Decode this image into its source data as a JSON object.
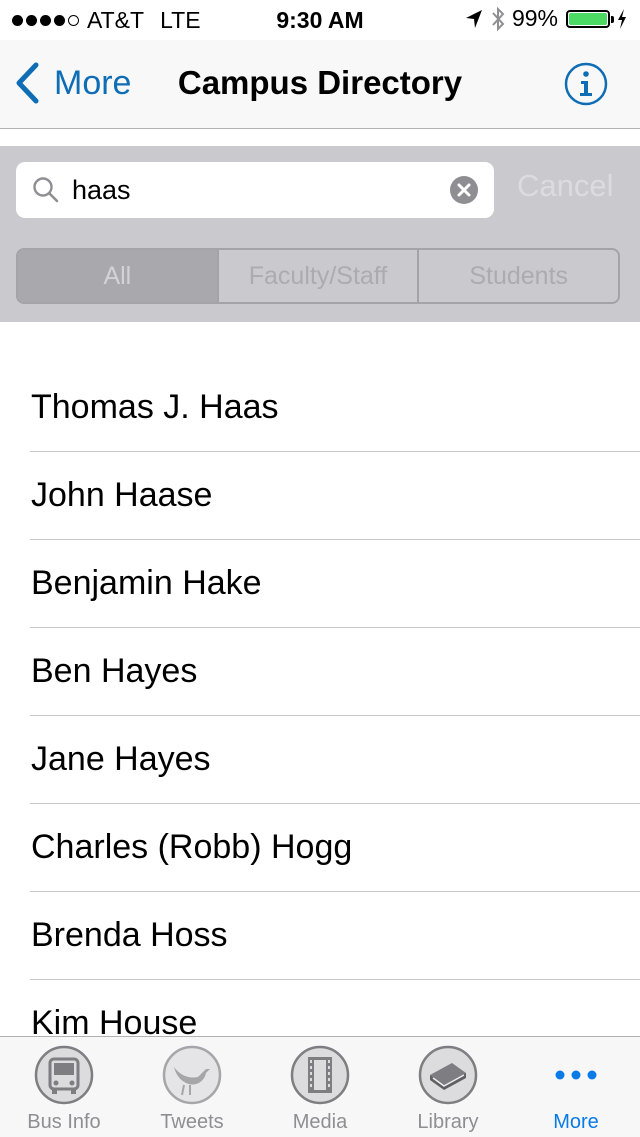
{
  "status_bar": {
    "carrier": "AT&T",
    "network": "LTE",
    "time": "9:30 AM",
    "battery_percent": "99%",
    "battery_level": 0.99,
    "signal_bars": 4,
    "signal_total": 5
  },
  "nav": {
    "back_label": "More",
    "title": "Campus Directory",
    "accent_color": "#0f6db6"
  },
  "search": {
    "value": "haas",
    "cancel_label": "Cancel"
  },
  "segments": {
    "items": [
      "All",
      "Faculty/Staff",
      "Students"
    ],
    "selected": "All"
  },
  "results": [
    "Thomas J. Haas",
    "John Haase",
    "Benjamin Hake",
    "Ben Hayes",
    "Jane Hayes",
    "Charles (Robb) Hogg",
    "Brenda Hoss",
    "Kim House"
  ],
  "tab_bar": {
    "tabs": [
      {
        "label": "Bus Info",
        "icon": "bus-icon"
      },
      {
        "label": "Tweets",
        "icon": "bird-icon"
      },
      {
        "label": "Media",
        "icon": "film-icon"
      },
      {
        "label": "Library",
        "icon": "book-icon"
      },
      {
        "label": "More",
        "icon": "more-dots-icon"
      }
    ],
    "selected": "More",
    "active_color": "#0a7ae6",
    "inactive_color": "#8e8e93"
  }
}
